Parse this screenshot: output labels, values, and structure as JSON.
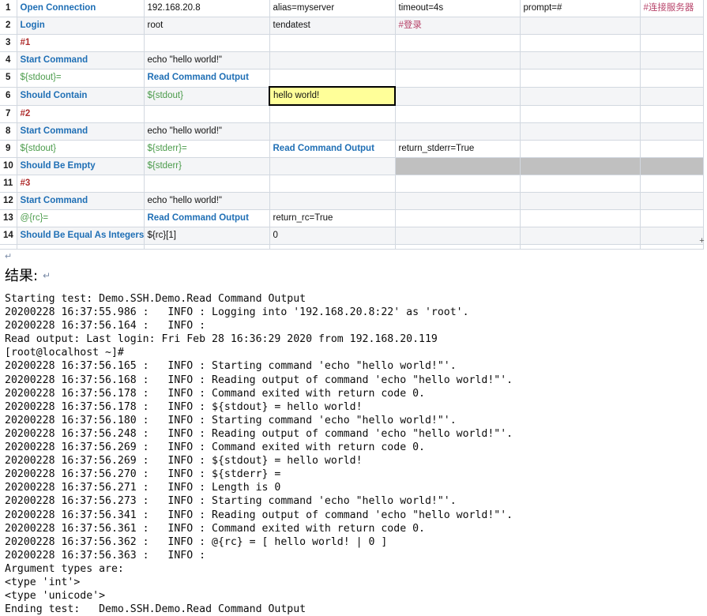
{
  "grid": {
    "columns": 6,
    "rows": [
      {
        "num": "1",
        "cells": [
          "Open Connection",
          "192.168.20.8",
          "alias=myserver",
          "timeout=4s",
          "prompt=#",
          "#连接服务器"
        ],
        "styles": [
          "kw",
          "plain",
          "plain",
          "plain",
          "plain",
          "cmt-cn"
        ]
      },
      {
        "num": "2",
        "cells": [
          "Login",
          "root",
          "tendatest",
          "#登录",
          "",
          ""
        ],
        "styles": [
          "kw",
          "plain",
          "plain",
          "cmt-cn",
          "plain",
          "plain"
        ]
      },
      {
        "num": "3",
        "cells": [
          "#1",
          "",
          "",
          "",
          "",
          ""
        ],
        "styles": [
          "comment",
          "plain",
          "plain",
          "plain",
          "plain",
          "plain"
        ]
      },
      {
        "num": "4",
        "cells": [
          "Start Command",
          "echo \"hello world!\"",
          "",
          "",
          "",
          ""
        ],
        "styles": [
          "kw",
          "plain",
          "plain",
          "plain",
          "plain",
          "plain"
        ]
      },
      {
        "num": "5",
        "cells": [
          "${stdout}=",
          "Read Command Output",
          "",
          "",
          "",
          ""
        ],
        "styles": [
          "var",
          "kw",
          "plain",
          "plain",
          "plain",
          "plain"
        ]
      },
      {
        "num": "6",
        "cells": [
          "Should Contain",
          "${stdout}",
          "hello world!",
          "",
          "",
          ""
        ],
        "styles": [
          "kw",
          "var",
          "selected",
          "plain",
          "plain",
          "plain"
        ]
      },
      {
        "num": "7",
        "cells": [
          "#2",
          "",
          "",
          "",
          "",
          ""
        ],
        "styles": [
          "comment",
          "plain",
          "plain",
          "plain",
          "plain",
          "plain"
        ]
      },
      {
        "num": "8",
        "cells": [
          "Start Command",
          "echo \"hello world!\"",
          "",
          "",
          "",
          ""
        ],
        "styles": [
          "kw",
          "plain",
          "plain",
          "plain",
          "plain",
          "plain"
        ]
      },
      {
        "num": "9",
        "cells": [
          "${stdout}",
          "${stderr}=",
          "Read Command Output",
          "return_stderr=True",
          "",
          ""
        ],
        "styles": [
          "var",
          "var",
          "kw",
          "plain",
          "plain",
          "plain"
        ]
      },
      {
        "num": "10",
        "cells": [
          "Should Be Empty",
          "${stderr}",
          "",
          "",
          "",
          ""
        ],
        "styles": [
          "kw",
          "var",
          "plain",
          "greyed",
          "greyed",
          "greyed"
        ]
      },
      {
        "num": "11",
        "cells": [
          "#3",
          "",
          "",
          "",
          "",
          ""
        ],
        "styles": [
          "comment",
          "plain",
          "plain",
          "plain",
          "plain",
          "plain"
        ]
      },
      {
        "num": "12",
        "cells": [
          "Start Command",
          "echo \"hello world!\"",
          "",
          "",
          "",
          ""
        ],
        "styles": [
          "kw",
          "plain",
          "plain",
          "plain",
          "plain",
          "plain"
        ]
      },
      {
        "num": "13",
        "cells": [
          "@{rc}=",
          "Read Command Output",
          "return_rc=True",
          "",
          "",
          ""
        ],
        "styles": [
          "var",
          "kw",
          "plain",
          "plain",
          "plain",
          "plain"
        ]
      },
      {
        "num": "14",
        "cells": [
          "Should Be Equal As Integers",
          "${rc}[1]",
          "0",
          "",
          "",
          ""
        ],
        "styles": [
          "kw",
          "plain",
          "plain",
          "plain",
          "plain",
          "plain"
        ]
      }
    ],
    "resize_handle": "+"
  },
  "document": {
    "blank_line_mark": "↵",
    "result_heading": "结果:",
    "result_heading_mark": "↵"
  },
  "console": {
    "lines": [
      "Starting test: Demo.SSH.Demo.Read Command Output",
      "20200228 16:37:55.986 :   INFO : Logging into '192.168.20.8:22' as 'root'.",
      "20200228 16:37:56.164 :   INFO :",
      "Read output: Last login: Fri Feb 28 16:36:29 2020 from 192.168.20.119",
      "[root@localhost ~]#",
      "20200228 16:37:56.165 :   INFO : Starting command 'echo \"hello world!\"'.",
      "20200228 16:37:56.168 :   INFO : Reading output of command 'echo \"hello world!\"'.",
      "20200228 16:37:56.178 :   INFO : Command exited with return code 0.",
      "20200228 16:37:56.178 :   INFO : ${stdout} = hello world!",
      "20200228 16:37:56.180 :   INFO : Starting command 'echo \"hello world!\"'.",
      "20200228 16:37:56.248 :   INFO : Reading output of command 'echo \"hello world!\"'.",
      "20200228 16:37:56.269 :   INFO : Command exited with return code 0.",
      "20200228 16:37:56.269 :   INFO : ${stdout} = hello world!",
      "20200228 16:37:56.270 :   INFO : ${stderr} =",
      "20200228 16:37:56.271 :   INFO : Length is 0",
      "20200228 16:37:56.273 :   INFO : Starting command 'echo \"hello world!\"'.",
      "20200228 16:37:56.341 :   INFO : Reading output of command 'echo \"hello world!\"'.",
      "20200228 16:37:56.361 :   INFO : Command exited with return code 0.",
      "20200228 16:37:56.362 :   INFO : @{rc} = [ hello world! | 0 ]",
      "20200228 16:37:56.363 :   INFO :",
      "Argument types are:",
      "<type 'int'>",
      "<type 'unicode'>",
      "Ending test:   Demo.SSH.Demo.Read Command Output"
    ]
  }
}
